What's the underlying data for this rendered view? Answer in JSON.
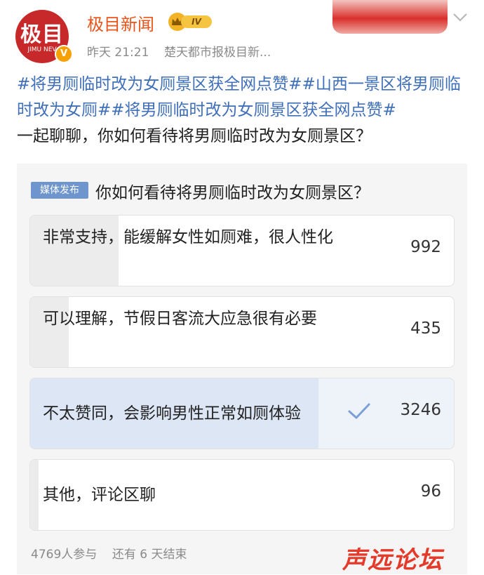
{
  "header": {
    "avatar_text": "极目",
    "avatar_sub": "JIMU NEV",
    "verified_mark": "V",
    "name": "极目新闻",
    "level": "IV",
    "time": "昨天 21:21",
    "source": "楚天都市报极目新..."
  },
  "post": {
    "tags": [
      "#将男厕临时改为女厕景区获全网点赞#",
      "#山西一景区将男厕临时改为女厕#",
      "#将男厕临时改为女厕景区获全网点赞#"
    ],
    "text": "一起聊聊，你如何看待将男厕临时改为女厕景区？"
  },
  "poll": {
    "badge": "媒体发布",
    "question": "你如何看待将男厕临时改为女厕景区？",
    "options": [
      {
        "label": "非常支持，能缓解女性如厕难，很人性化",
        "count": "992",
        "share": 0.208,
        "selected": false
      },
      {
        "label": "可以理解，节假日客流大应急很有必要",
        "count": "435",
        "share": 0.091,
        "selected": false
      },
      {
        "label": "不太赞同，会影响男性正常如厕体验",
        "count": "3246",
        "share": 0.681,
        "selected": true
      },
      {
        "label": "其他，评论区聊",
        "count": "96",
        "share": 0.02,
        "selected": false
      }
    ],
    "participants": "4769人参与",
    "remaining": "还有 6 天结束"
  },
  "watermark": "声远论坛",
  "colors": {
    "accent": "#e8551b",
    "tag": "#3f6fb8",
    "badge": "#6e95cd",
    "selected_fill": "#dde6f5"
  },
  "icons": [
    "chevron-down-icon",
    "checkmark-icon",
    "crown-icon"
  ]
}
